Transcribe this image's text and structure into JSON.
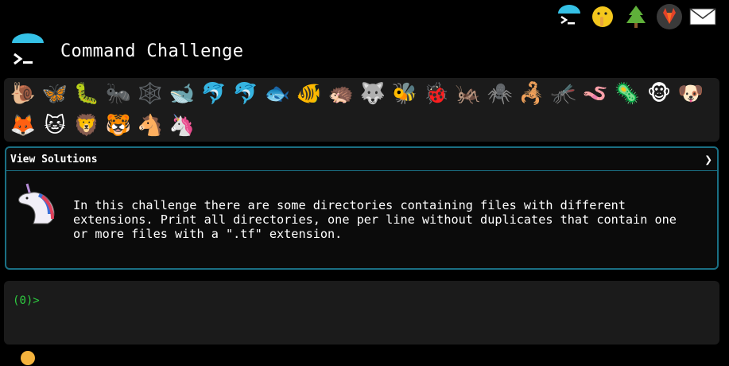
{
  "nav": {
    "items": [
      {
        "name": "terminal-umbrella-icon"
      },
      {
        "name": "shushing-face-icon"
      },
      {
        "name": "tree-icon"
      },
      {
        "name": "gitlab-icon"
      },
      {
        "name": "mail-icon"
      }
    ]
  },
  "header": {
    "title": "Command Challenge"
  },
  "levels": {
    "row1": [
      "🐌",
      "🦋",
      "🐛",
      "🐜",
      "🕸️",
      "🐋",
      "🐬",
      "🐬",
      "🐟",
      "🐠",
      "🦔",
      "🐺",
      "🐝",
      "🐞",
      "🦗",
      "🕷️",
      "🦂",
      "🦟",
      "🪱",
      "🦠",
      "🐵",
      "🐶"
    ],
    "row2": [
      "🦊",
      "🐱",
      "🦁",
      "🐯",
      "🐴",
      "🦄"
    ]
  },
  "solutions": {
    "label": "View Solutions",
    "chevron": "❯",
    "description": "In this challenge there are some directories containing files with different\nextensions. Print all directories, one per line without duplicates that contain one\nor more files with a \".tf\" extension."
  },
  "terminal": {
    "prompt_open": "(",
    "prompt_num": "0",
    "prompt_close": ")>"
  },
  "colors": {
    "accent": "#1a6f84",
    "prompt": "#2ecc40",
    "umbrella": "#35c1e6"
  }
}
